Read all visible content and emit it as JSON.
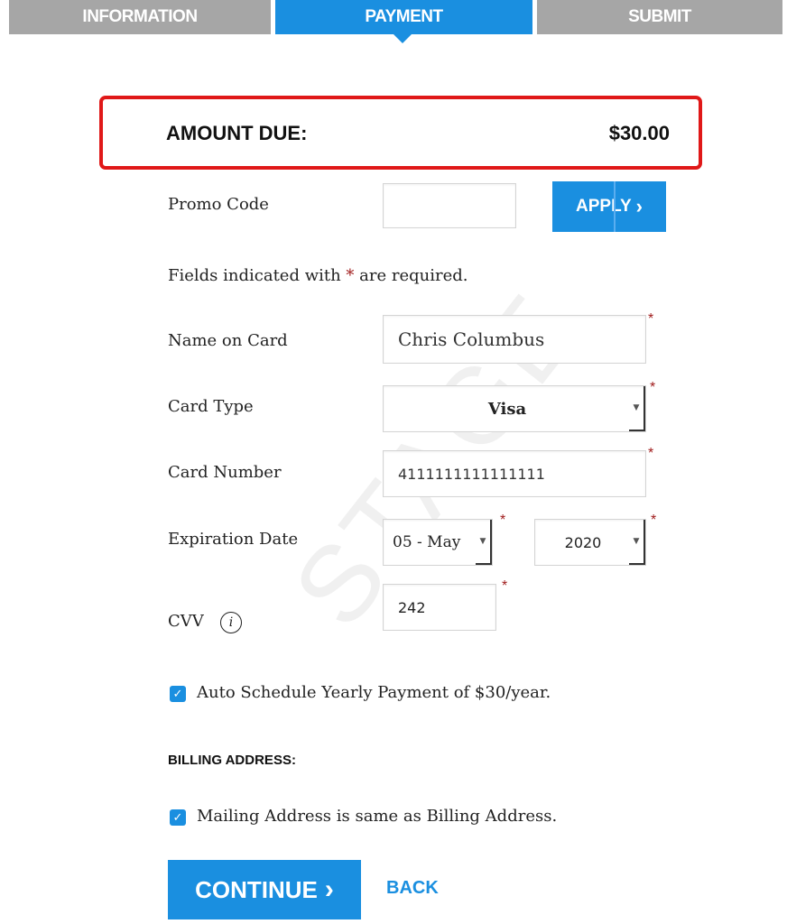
{
  "steps": {
    "information": "INFORMATION",
    "payment": "PAYMENT",
    "submit": "SUBMIT"
  },
  "amount": {
    "label": "AMOUNT DUE:",
    "value": "$30.00"
  },
  "promo": {
    "label": "Promo Code",
    "value": "",
    "apply_label": "APPLY",
    "apply_arrow": "›"
  },
  "required_note": {
    "before": "Fields indicated with ",
    "star": "*",
    "after": " are required."
  },
  "name_on_card": {
    "label": "Name on Card",
    "value": "Chris Columbus"
  },
  "card_type": {
    "label": "Card Type",
    "value": "Visa"
  },
  "card_number": {
    "label": "Card Number",
    "value": "4111111111111111"
  },
  "expiration": {
    "label": "Expiration Date",
    "month": "05 - May",
    "year": "2020"
  },
  "cvv": {
    "label": "CVV",
    "value": "242",
    "info_glyph": "i"
  },
  "auto_schedule": {
    "label": "Auto Schedule Yearly Payment of $30/year.",
    "checked": true
  },
  "billing": {
    "heading": "BILLING ADDRESS:",
    "same_label": "Mailing Address is same as Billing Address.",
    "same_checked": true
  },
  "watermark": "STAGE",
  "actions": {
    "continue_label": "CONTINUE",
    "continue_arrow": "›",
    "back_label": "BACK"
  },
  "required_star": "*",
  "check_glyph": "✓",
  "colors": {
    "accent": "#1a8fe0",
    "inactive_tab": "#a6a6a6",
    "highlight_border": "#e01818",
    "required": "#a01c1c"
  }
}
